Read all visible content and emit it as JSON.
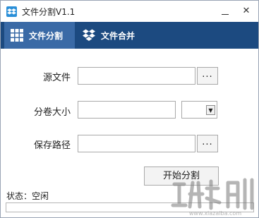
{
  "window": {
    "title": "文件分割V1.1",
    "minimize_glyph": "—",
    "close_glyph": "✕"
  },
  "toolbar": {
    "tabs": [
      {
        "label": "文件分割",
        "icon": "grid-icon",
        "active": true
      },
      {
        "label": "文件合并",
        "icon": "dropbox-icon",
        "active": false
      }
    ]
  },
  "form": {
    "source_label": "源文件",
    "source_value": "",
    "source_browse": "...",
    "volume_label": "分卷大小",
    "volume_value": "",
    "volume_unit": "",
    "save_label": "保存路径",
    "save_value": "",
    "save_browse": "...",
    "start_button": "开始分割"
  },
  "status": {
    "text": "状态：空闲",
    "progress": 0
  },
  "colors": {
    "toolbar_bg": "#1c4a80",
    "active_tab_bg": "#3a6aa6",
    "accent": "#2a8fd8"
  },
  "watermark": {
    "icon": "watermark-logo"
  }
}
